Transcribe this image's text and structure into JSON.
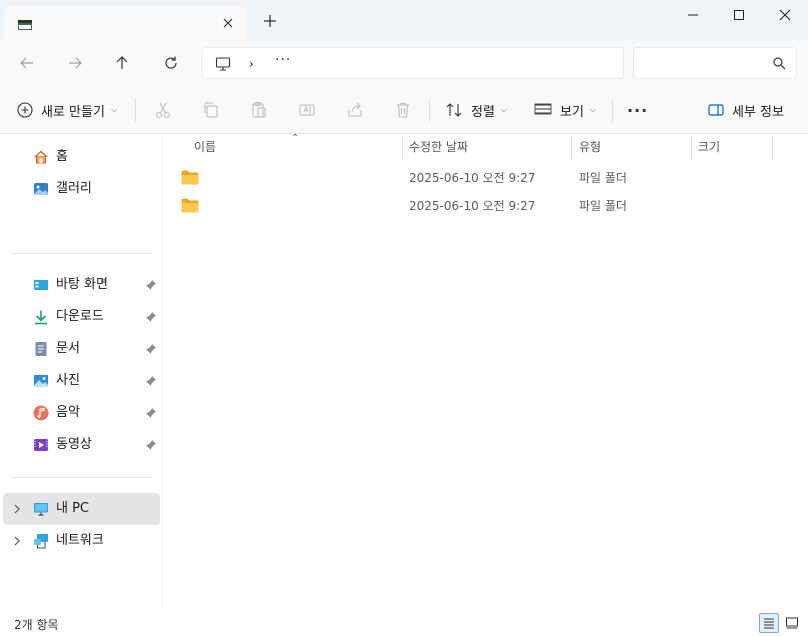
{
  "titlebar": {
    "tab_title": "",
    "tab_icon": "file-explorer-icon",
    "close_tab_icon": "close-icon",
    "new_tab_icon": "plus-icon",
    "window_controls": [
      "minimize-icon",
      "maximize-icon",
      "close-icon"
    ]
  },
  "navbar": {
    "back_icon": "arrow-left-icon",
    "forward_icon": "arrow-right-icon",
    "up_icon": "arrow-up-icon",
    "refresh_icon": "refresh-icon",
    "address": {
      "location_icon": "this-pc-icon",
      "separator": "›",
      "overflow": "···"
    },
    "search": {
      "placeholder": "",
      "icon": "search-icon"
    }
  },
  "commandbar": {
    "new_label": "새로 만들기",
    "sort_label": "정렬",
    "view_label": "보기",
    "more_label": "···",
    "details_label": "세부 정보",
    "disabled_actions": [
      "cut-icon",
      "copy-icon",
      "paste-icon",
      "rename-icon",
      "share-icon",
      "delete-icon"
    ]
  },
  "sidebar": {
    "top": [
      {
        "label": "홈",
        "icon": "home-icon"
      },
      {
        "label": "갤러리",
        "icon": "gallery-icon"
      }
    ],
    "pinned": [
      {
        "label": "바탕 화면",
        "icon": "desktop-icon"
      },
      {
        "label": "다운로드",
        "icon": "download-icon"
      },
      {
        "label": "문서",
        "icon": "documents-icon"
      },
      {
        "label": "사진",
        "icon": "pictures-icon"
      },
      {
        "label": "음악",
        "icon": "music-icon"
      },
      {
        "label": "동영상",
        "icon": "videos-icon"
      }
    ],
    "bottom": [
      {
        "label": "내 PC",
        "icon": "this-pc-icon",
        "selected": true
      },
      {
        "label": "네트워크",
        "icon": "network-icon",
        "selected": false
      }
    ]
  },
  "table": {
    "columns": [
      "이름",
      "수정한 날짜",
      "유형",
      "크기"
    ],
    "rows": [
      {
        "name": "",
        "modified": "2025-06-10 오전 9:27",
        "type": "파일 폴더",
        "size": ""
      },
      {
        "name": "",
        "modified": "2025-06-10 오전 9:27",
        "type": "파일 폴더",
        "size": ""
      }
    ]
  },
  "status": {
    "item_count": "2개 항목"
  },
  "colors": {
    "accent": "#0067c0",
    "folder": "#f8c94b",
    "selected_bg": "#e5e5e5"
  }
}
